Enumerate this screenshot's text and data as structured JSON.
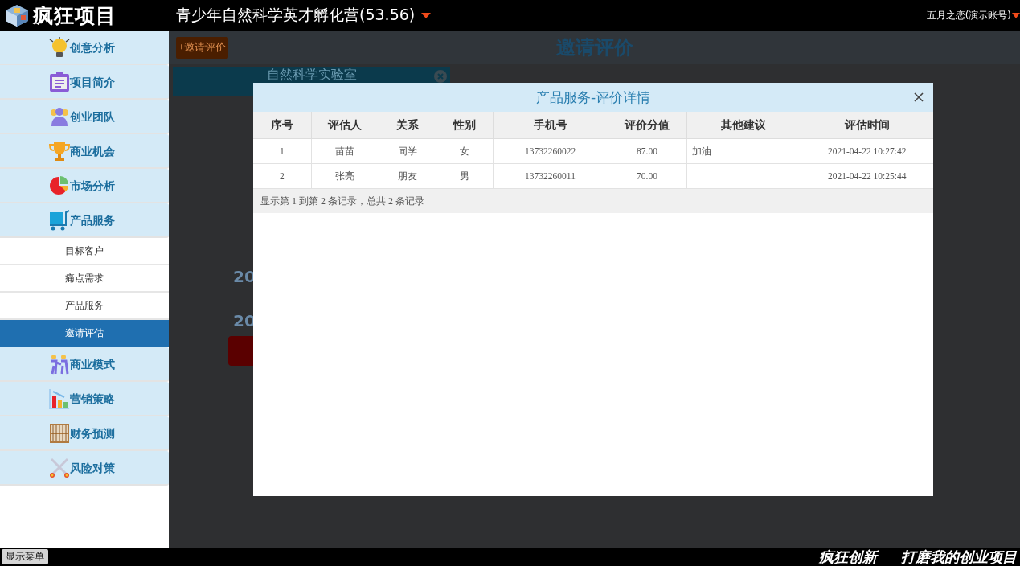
{
  "header": {
    "logo": "疯狂项目",
    "project": "青少年自然科学英才孵化营(53.56)",
    "user": "五月之恋(演示账号)"
  },
  "sidebar": {
    "items": [
      {
        "label": "创意分析"
      },
      {
        "label": "项目简介"
      },
      {
        "label": "创业团队"
      },
      {
        "label": "商业机会"
      },
      {
        "label": "市场分析"
      },
      {
        "label": "产品服务",
        "children": [
          {
            "label": "目标客户",
            "selected": false
          },
          {
            "label": "痛点需求",
            "selected": false
          },
          {
            "label": "产品服务",
            "selected": false
          },
          {
            "label": "邀请评估",
            "selected": true
          }
        ]
      },
      {
        "label": "商业模式"
      },
      {
        "label": "营销策略"
      },
      {
        "label": "财务预测"
      },
      {
        "label": "风险对策"
      }
    ]
  },
  "page": {
    "add_button": "+邀请评价",
    "title": "邀请评价",
    "card": {
      "title": "自然科学实验室"
    },
    "lines": [
      "20",
      "20"
    ]
  },
  "dialog": {
    "title": "产品服务-评价详情",
    "columns": [
      "序号",
      "评估人",
      "关系",
      "性别",
      "手机号",
      "评价分值",
      "其他建议",
      "评估时间"
    ],
    "rows": [
      {
        "index": "1",
        "assessor": "苗苗",
        "relation": "同学",
        "gender": "女",
        "phone": "13732260022",
        "score": "87.00",
        "suggestion": "加油",
        "time": "2021-04-22 10:27:42"
      },
      {
        "index": "2",
        "assessor": "张亮",
        "relation": "朋友",
        "gender": "男",
        "phone": "13732260011",
        "score": "70.00",
        "time": "2021-04-22 10:25:44"
      }
    ],
    "summary": "显示第 1 到第 2 条记录，总共 2 条记录"
  },
  "footer": {
    "menu_button": "显示菜单",
    "slogans": [
      "疯狂创新",
      "打磨我的创业项目"
    ]
  }
}
